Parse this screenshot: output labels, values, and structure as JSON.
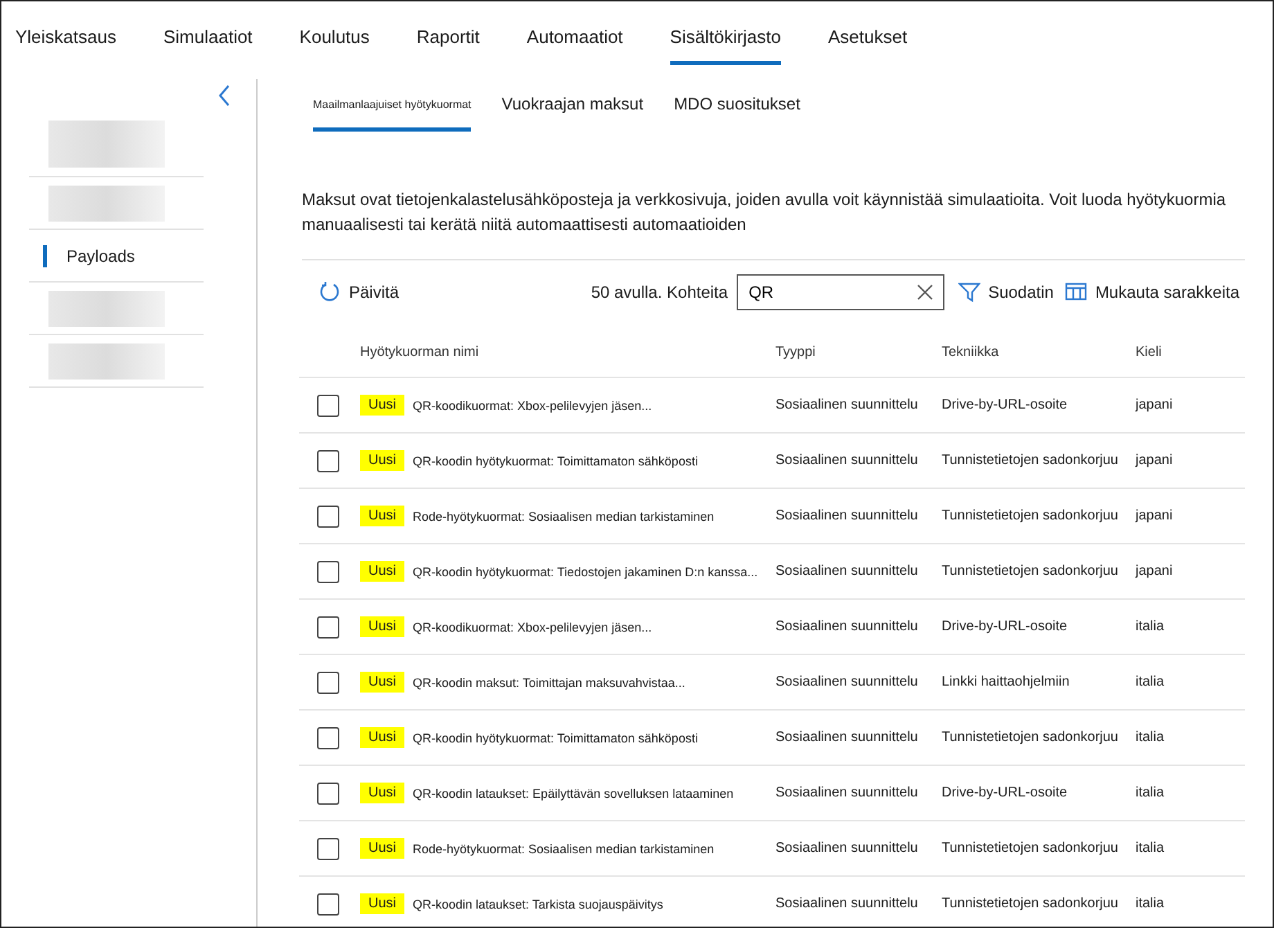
{
  "nav": {
    "tabs": [
      {
        "label": "Yleiskatsaus",
        "selected": false
      },
      {
        "label": "Simulaatiot",
        "selected": false
      },
      {
        "label": "Koulutus",
        "selected": false
      },
      {
        "label": "Raportit",
        "selected": false
      },
      {
        "label": "Automaatiot",
        "selected": false
      },
      {
        "label": "Sisältökirjasto",
        "selected": true
      },
      {
        "label": "Asetukset",
        "selected": false
      }
    ]
  },
  "sidebar": {
    "items": [
      {
        "kind": "redacted",
        "selected": false
      },
      {
        "kind": "redacted",
        "selected": false
      },
      {
        "kind": "text",
        "label": "Payloads",
        "selected": true
      },
      {
        "kind": "redacted",
        "selected": false
      },
      {
        "kind": "redacted",
        "selected": false
      }
    ]
  },
  "subtabs": [
    {
      "label": "Maailmanlaajuiset hyötykuormat",
      "selected": true
    },
    {
      "label": "Vuokraajan maksut",
      "selected": false
    },
    {
      "label": "MDO suositukset",
      "selected": false
    }
  ],
  "description": "Maksut ovat tietojenkalastelusähköposteja ja verkkosivuja, joiden avulla voit käynnistää simulaatioita. Voit luoda hyötykuormia manuaalisesti tai kerätä niitä automaattisesti automaatioiden",
  "toolbar": {
    "refresh": "Päivitä",
    "count": "50 avulla. Kohteita",
    "search": {
      "value": "QR"
    },
    "filter": "Suodatin",
    "customize": "Mukauta sarakkeita"
  },
  "table": {
    "columns": [
      "Hyötykuorman nimi",
      "Tyyppi",
      "Tekniikka",
      "Kieli"
    ],
    "rows": [
      {
        "checked": false,
        "badge": "Uusi",
        "name": "QR-koodikuormat: Xbox-pelilevyjen jäsen...",
        "type": "Sosiaalinen suunnittelu",
        "technique": "Drive-by-URL-osoite",
        "language": "japani"
      },
      {
        "checked": false,
        "badge": "Uusi",
        "name": "QR-koodin hyötykuormat: Toimittamaton sähköposti",
        "type": "Sosiaalinen suunnittelu",
        "technique": "Tunnistetietojen sadonkorjuu",
        "language": "japani"
      },
      {
        "checked": false,
        "badge": "Uusi",
        "name": "Rode-hyötykuormat: Sosiaalisen median tarkistaminen",
        "type": "Sosiaalinen suunnittelu",
        "technique": "Tunnistetietojen sadonkorjuu",
        "language": "japani"
      },
      {
        "checked": false,
        "badge": "Uusi",
        "name": "QR-koodin hyötykuormat: Tiedostojen jakaminen D:n kanssa...",
        "type": "Sosiaalinen suunnittelu",
        "technique": "Tunnistetietojen sadonkorjuu",
        "language": "japani"
      },
      {
        "checked": false,
        "badge": "Uusi",
        "name": "QR-koodikuormat: Xbox-pelilevyjen jäsen...",
        "type": "Sosiaalinen suunnittelu",
        "technique": "Drive-by-URL-osoite",
        "language": "italia"
      },
      {
        "checked": false,
        "badge": "Uusi",
        "name": "QR-koodin maksut: Toimittajan maksuvahvistaa...",
        "type": "Sosiaalinen suunnittelu",
        "technique": "Linkki haittaohjelmiin",
        "language": "italia"
      },
      {
        "checked": false,
        "badge": "Uusi",
        "name": "QR-koodin hyötykuormat: Toimittamaton sähköposti",
        "type": "Sosiaalinen suunnittelu",
        "technique": "Tunnistetietojen sadonkorjuu",
        "language": "italia"
      },
      {
        "checked": false,
        "badge": "Uusi",
        "name": "QR-koodin lataukset: Epäilyttävän sovelluksen lataaminen",
        "type": "Sosiaalinen suunnittelu",
        "technique": "Drive-by-URL-osoite",
        "language": "italia"
      },
      {
        "checked": false,
        "badge": "Uusi",
        "name": "Rode-hyötykuormat: Sosiaalisen median tarkistaminen",
        "type": "Sosiaalinen suunnittelu",
        "technique": "Tunnistetietojen sadonkorjuu",
        "language": "italia"
      },
      {
        "checked": false,
        "badge": "Uusi",
        "name": "QR-koodin lataukset: Tarkista suojauspäivitys",
        "type": "Sosiaalinen suunnittelu",
        "technique": "Tunnistetietojen sadonkorjuu",
        "language": "italia"
      }
    ]
  }
}
